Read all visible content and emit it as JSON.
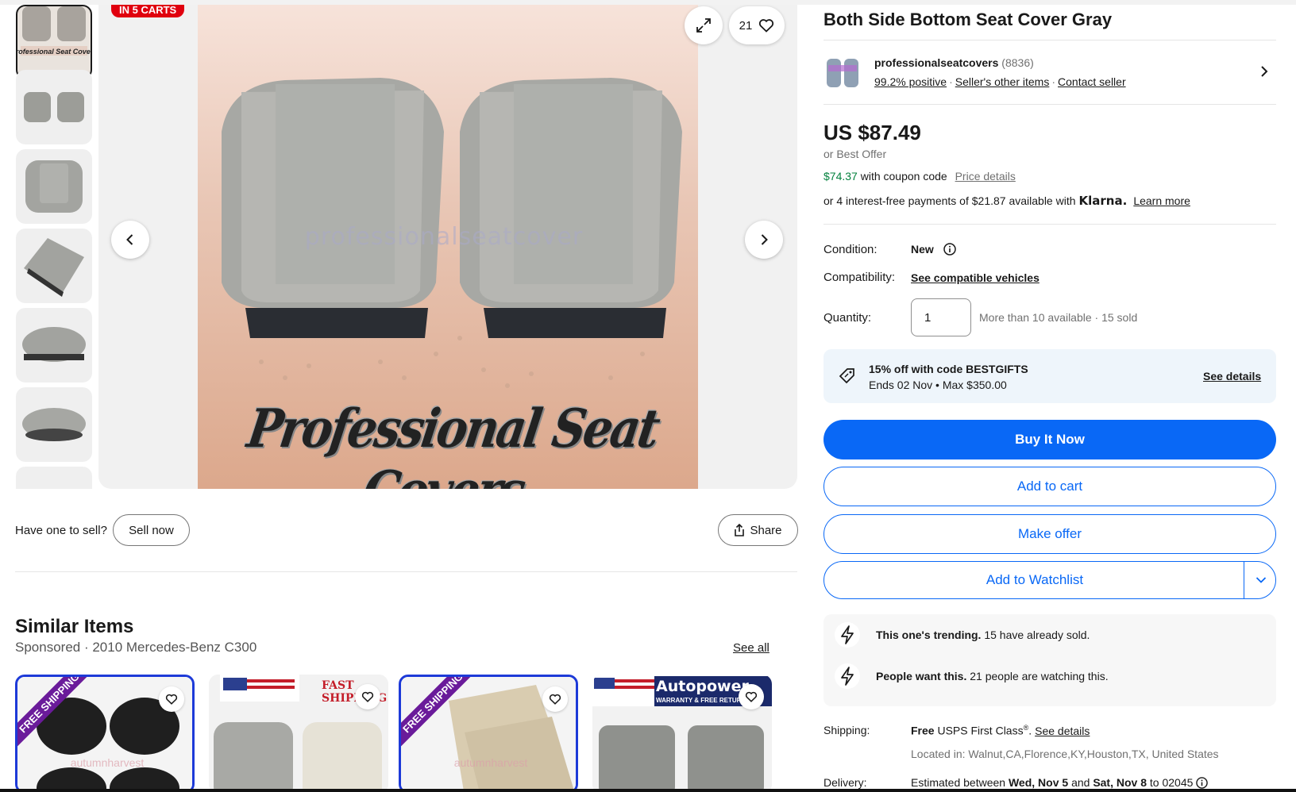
{
  "gallery": {
    "carts_badge": "IN 5 CARTS",
    "watch_count": "21",
    "watermark": "professionalseatcover",
    "brand_text": "Professional Seat Covers"
  },
  "actions_left": {
    "have_one": "Have one to sell?",
    "sell_now": "Sell now",
    "share": "Share"
  },
  "similar": {
    "title": "Similar Items",
    "subtitle": "Sponsored · 2010 Mercedes-Benz C300",
    "see_all": "See all",
    "cards": [
      {
        "ribbon": "FREE SHIPPING",
        "watermark": "autumnharvest"
      },
      {
        "banner": "FAST SHIPPING"
      },
      {
        "ribbon": "FREE SHIPPING",
        "watermark": "autumnharvest"
      },
      {
        "banner": "Autopower",
        "banner_sub": "WARRANTY & FREE RETURN"
      }
    ]
  },
  "listing": {
    "title": "Both Side Bottom Seat Cover Gray",
    "seller": {
      "name": "professionalseatcovers",
      "count": "(8836)",
      "positive": "99.2% positive",
      "other_items": "Seller's other items",
      "contact": "Contact seller"
    },
    "price": "US $87.49",
    "best_offer": "or Best Offer",
    "coupon_price": "$74.37",
    "coupon_text": "with coupon code",
    "price_details": "Price details",
    "klarna_text": "or 4 interest-free payments of $21.87 available with",
    "klarna_brand": "Klarna.",
    "learn_more": "Learn more",
    "condition_label": "Condition:",
    "condition_value": "New",
    "compat_label": "Compatibility:",
    "compat_value": "See compatible vehicles",
    "quantity_label": "Quantity:",
    "quantity_value": "1",
    "quantity_note": "More than 10 available · 15 sold",
    "promo": {
      "line1": "15% off with code BESTGIFTS",
      "line2": "Ends 02 Nov • Max $350.00",
      "see_details": "See details"
    },
    "buttons": {
      "buy": "Buy It Now",
      "cart": "Add to cart",
      "offer": "Make offer",
      "watch": "Add to Watchlist"
    },
    "trending": [
      {
        "bold": "This one's trending.",
        "text": "15 have already sold."
      },
      {
        "bold": "People want this.",
        "text": "21 people are watching this."
      }
    ],
    "shipping_label": "Shipping:",
    "shipping_free": "Free",
    "shipping_method": "USPS First Class",
    "shipping_reg": "®",
    "shipping_see": "See details",
    "located": "Located in: Walnut,CA,Florence,KY,Houston,TX, United States",
    "delivery_label": "Delivery:",
    "delivery_pre": "Estimated between",
    "delivery_from": "Wed, Nov 5",
    "delivery_and": "and",
    "delivery_to": "Sat, Nov 8",
    "delivery_zip": "to 02045"
  },
  "colors": {
    "accent": "#0968f6",
    "badge": "#e0000e",
    "coupon": "#05823f",
    "promo_bg": "#eef5fb"
  }
}
